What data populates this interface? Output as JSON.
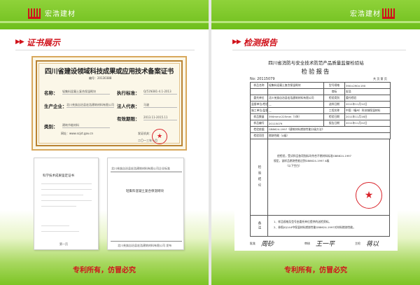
{
  "brand": {
    "name": "宏浩建材",
    "accent": "#7cc424",
    "red": "#d0121b"
  },
  "left": {
    "section_title": "证书展示",
    "certificate": {
      "title": "四川省建设领域科技成果或应用技术备案证书",
      "number": "编号：20130388",
      "rows": [
        {
          "label": "名称：",
          "value": "轻集料混凝土复合保温砌块"
        },
        {
          "label": "执行标准：",
          "value": "Q/51N381-4.1-2013"
        },
        {
          "label": "生产企业：",
          "value": "北川羌族自治县宏浩建筑材料有限公司"
        },
        {
          "label": "法人代表：",
          "value": "马骏"
        },
        {
          "label": "有效期限：",
          "value": "2013.11-2015.11"
        },
        {
          "label": "类别：",
          "value": "建筑节能材料"
        }
      ],
      "website": "网址：www.scjst.gov.cn",
      "issuer": "发证机关：",
      "date": "二〇一三年十月"
    },
    "doc1": {
      "title": "科学技术成果鉴定证书",
      "note": "第一页"
    },
    "doc2": {
      "header": "北川羌族自治县宏浩建筑材料有限公司企业标准",
      "product": "轻集料混凝土复合保温砌块",
      "footer": "北川羌族自治县宏浩建筑材料有限公司 发布"
    },
    "footer": "专利所有，仿冒必究"
  },
  "right": {
    "section_title": "检测报告",
    "report": {
      "org": "四川省消防与安全技术防范产品质量监督检验站",
      "title": "检验报告",
      "number": "No: 20115079",
      "page": "共 页 第 页",
      "rows": [
        [
          "样品名称",
          "轻集料混凝土复合保温砌块",
          "型号规格",
          "390×290×190"
        ],
        [
          "",
          "",
          "商标",
          "宏浩"
        ],
        [
          "委托单位",
          "北川羌族自治县宏浩建筑材料有限公司",
          "检验类别",
          "委托检验"
        ],
        [
          "监督单位/检验项目",
          "—",
          "送样日期",
          "2011年11月12日"
        ],
        [
          "施工单位/监督人员",
          "—",
          "工程名称",
          "中国（福州）科技城保温材料"
        ],
        [
          "样品数量",
          "390mm×225mm（3块）",
          "检验日期",
          "2011年11月16日"
        ],
        [
          "样品编号",
          "20115079",
          "报告日期",
          "2011年11月22日"
        ],
        [
          "检验依据",
          "GB8624-1997《建筑材料燃烧性能分级方法》",
          "",
          ""
        ],
        [
          "检验项目",
          "燃烧性能（A级）",
          "",
          ""
        ]
      ],
      "conclusion_label": "检验结论",
      "conclusion": [
        "经检验，受试样品各项指标均符合不燃材料标准GB8624-1997",
        "规定，该样品燃烧性能达到GB8624-1997 A级",
        "（以下空白）"
      ],
      "remarks": [
        "1、样品规格及型号由委托单位提供的送检资料。",
        "2、参照JGJ144中保温材料燃烧性能GB8624-1997对材料燃烧性能。"
      ],
      "signatures": [
        "批准",
        "审核",
        "主检"
      ]
    },
    "footer": "专利所有，仿冒必究"
  }
}
